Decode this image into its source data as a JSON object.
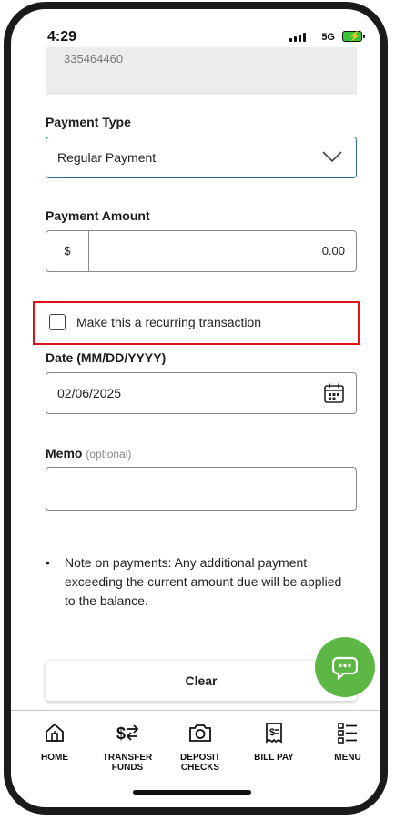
{
  "status_bar": {
    "time": "4:29",
    "network": "5G"
  },
  "account": {
    "value": "335464460"
  },
  "payment_type": {
    "label": "Payment Type",
    "selected": "Regular Payment"
  },
  "payment_amount": {
    "label": "Payment Amount",
    "currency_symbol": "$",
    "value": "0.00"
  },
  "recurring": {
    "label": "Make this a recurring transaction",
    "checked": false,
    "highlight_color": "#e0131a"
  },
  "date": {
    "label": "Date (MM/DD/YYYY)",
    "value": "02/06/2025"
  },
  "memo": {
    "label": "Memo",
    "optional": "(optional)",
    "value": ""
  },
  "note": {
    "bullet": "•",
    "text": "Note on payments: Any additional payment exceeding the current amount due will be applied to the balance."
  },
  "buttons": {
    "clear": "Clear"
  },
  "chat": {
    "icon": "chat-bubble-icon",
    "color": "#5db744"
  },
  "nav": [
    {
      "label_line1": "HOME",
      "label_line2": "",
      "icon": "home-icon"
    },
    {
      "label_line1": "TRANSFER",
      "label_line2": "FUNDS",
      "icon": "transfer-icon"
    },
    {
      "label_line1": "DEPOSIT",
      "label_line2": "CHECKS",
      "icon": "camera-icon"
    },
    {
      "label_line1": "BILL PAY",
      "label_line2": "",
      "icon": "bill-icon"
    },
    {
      "label_line1": "MENU",
      "label_line2": "",
      "icon": "menu-icon"
    }
  ]
}
